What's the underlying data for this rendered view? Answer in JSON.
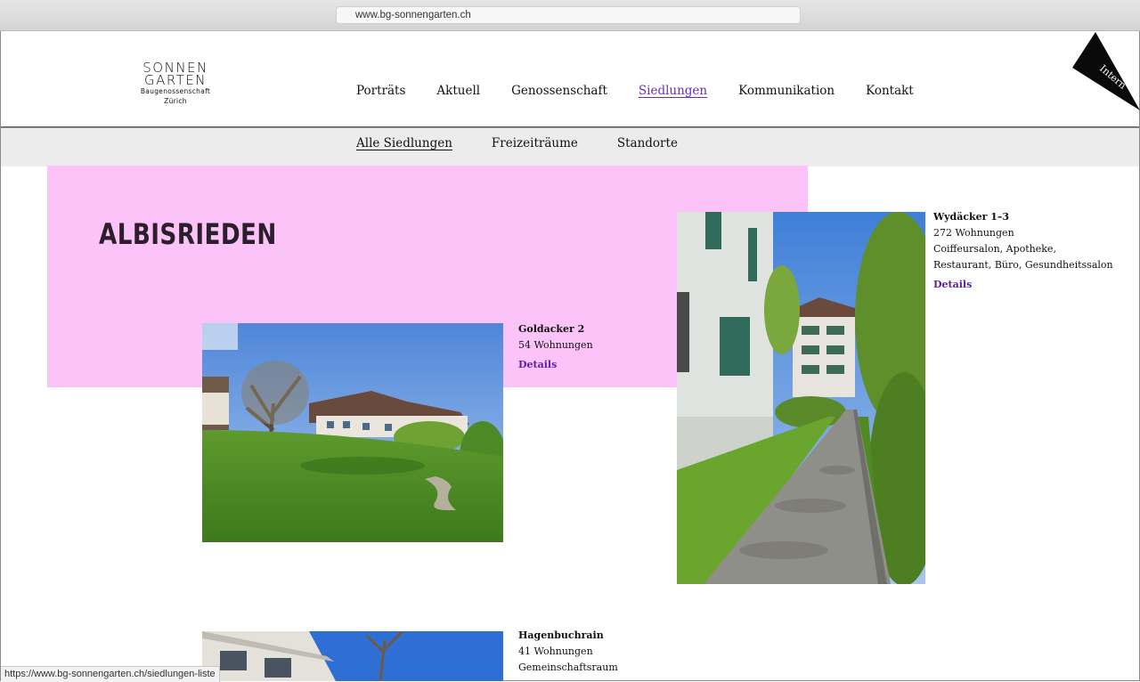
{
  "browser": {
    "url": "www.bg-sonnengarten.ch"
  },
  "logo": {
    "line1": "SONNEN",
    "line2": "GARTEN",
    "line3": "Baugenossenschaft Zürich"
  },
  "nav": {
    "items": [
      "Porträts",
      "Aktuell",
      "Genossenschaft",
      "Siedlungen",
      "Kommunikation",
      "Kontakt"
    ],
    "active": "Siedlungen"
  },
  "intern_label": "Intern",
  "subnav": {
    "items": [
      "Alle Siedlungen",
      "Freizeiträume",
      "Standorte"
    ],
    "active": "Alle Siedlungen"
  },
  "page": {
    "heading": "ALBISRIEDEN"
  },
  "settlements": [
    {
      "name": "Goldacker 2",
      "units": "54 Wohnungen",
      "link": "Details"
    },
    {
      "name": "Wydäcker 1–3",
      "units": "272 Wohnungen",
      "amenities": "Coiffeursalon, Apotheke, Restaurant, Büro, Gesundheitssalon",
      "link": "Details"
    },
    {
      "name": "Hagenbuchrain",
      "units": "41 Wohnungen",
      "amenities": "Gemeinschaftsraum"
    }
  ],
  "status_url": "https://www.bg-sonnengarten.ch/siedlungen-liste",
  "colors": {
    "pink_band": "#fbc3f7",
    "link_purple": "#5b1fa0",
    "nav_active": "#6a2fb0"
  }
}
